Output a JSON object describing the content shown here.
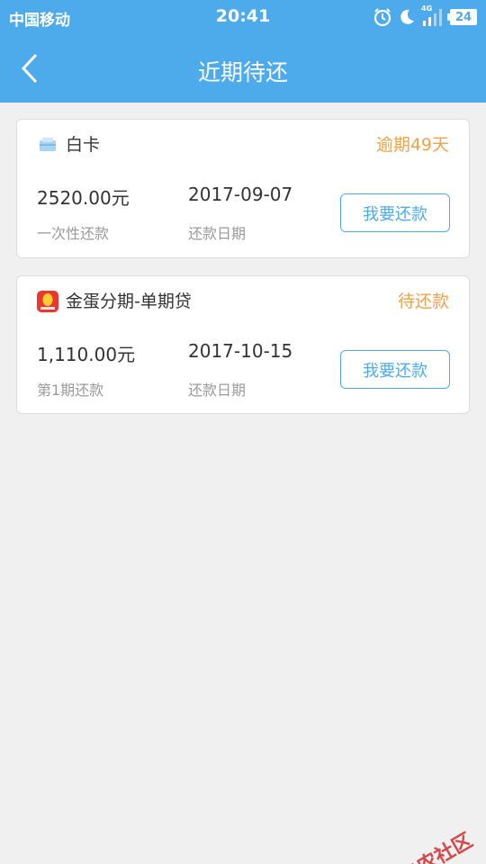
{
  "status_bar": {
    "carrier": "中国移动",
    "time": "20:41",
    "network": "4G",
    "battery": "24",
    "icons": [
      "alarm-icon",
      "moon-icon",
      "signal-icon",
      "battery-icon"
    ]
  },
  "nav": {
    "title": "近期待还",
    "back_icon": "chevron-left-icon"
  },
  "loans": [
    {
      "name": "白卡",
      "icon": "card-icon",
      "status": "逾期49天",
      "amount": "2520.00元",
      "amount_label": "一次性还款",
      "date": "2017-09-07",
      "date_label": "还款日期",
      "button_label": "我要还款"
    },
    {
      "name": "金蛋分期-单期贷",
      "icon": "golden-egg-icon",
      "status": "待还款",
      "amount": "1,110.00元",
      "amount_label": "第1期还款",
      "date": "2017-10-15",
      "date_label": "还款日期",
      "button_label": "我要还款"
    }
  ],
  "watermark": {
    "text": "卡农社区"
  },
  "colors": {
    "primary": "#4dabec",
    "warning": "#f0a24a",
    "background": "#f0f0f0"
  }
}
